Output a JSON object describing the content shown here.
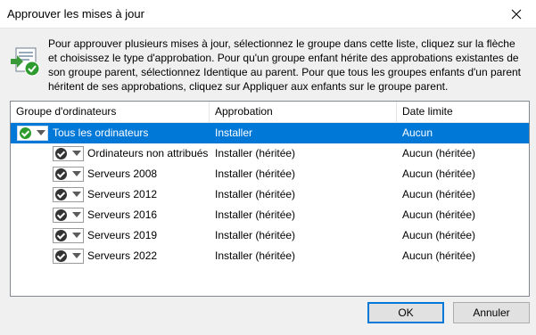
{
  "window": {
    "title": "Approuver les mises à jour"
  },
  "description": "Pour approuver plusieurs mises à jour, sélectionnez le groupe dans cette liste, cliquez sur la flèche et choisissez le type d'approbation. Pour qu'un groupe enfant hérite des approbations existantes de son groupe parent, sélectionnez Identique au parent. Pour que tous les groupes enfants d'un parent héritent de ses approbations, cliquez sur Appliquer aux enfants sur le groupe parent.",
  "columns": [
    "Groupe d'ordinateurs",
    "Approbation",
    "Date limite"
  ],
  "rows": [
    {
      "group": "Tous les ordinateurs",
      "approval": "Installer",
      "deadline": "Aucun"
    },
    {
      "group": "Ordinateurs non attribués",
      "approval": "Installer (héritée)",
      "deadline": "Aucun (héritée)"
    },
    {
      "group": "Serveurs 2008",
      "approval": "Installer (héritée)",
      "deadline": "Aucun (héritée)"
    },
    {
      "group": "Serveurs 2012",
      "approval": "Installer (héritée)",
      "deadline": "Aucun (héritée)"
    },
    {
      "group": "Serveurs 2016",
      "approval": "Installer (héritée)",
      "deadline": "Aucun (héritée)"
    },
    {
      "group": "Serveurs 2019",
      "approval": "Installer (héritée)",
      "deadline": "Aucun (héritée)"
    },
    {
      "group": "Serveurs 2022",
      "approval": "Installer (héritée)",
      "deadline": "Aucun (héritée)"
    }
  ],
  "buttons": {
    "ok": "OK",
    "cancel": "Annuler"
  },
  "colors": {
    "selection": "#0078d7",
    "approved_green": "#2e9b2e"
  },
  "icons": {
    "header": "approve-updates-icon",
    "close": "close-icon",
    "approval_state": "check-circle-icon",
    "approval_dropdown": "dropdown-arrow-icon"
  }
}
